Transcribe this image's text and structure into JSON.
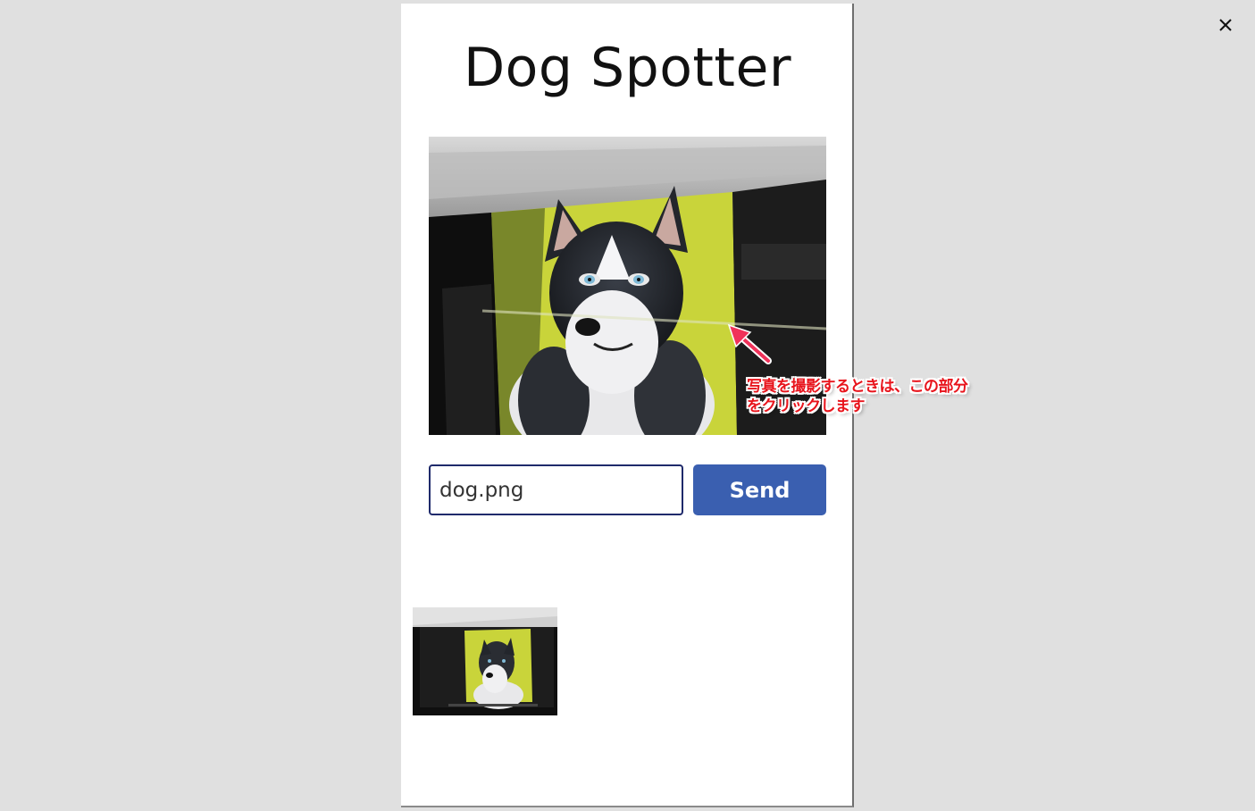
{
  "window": {
    "close_icon": "close-icon"
  },
  "app": {
    "title": "Dog Spotter",
    "camera": {
      "icon": "camera-preview",
      "accent_background": "#c9d43a"
    },
    "filename_input": {
      "value": "dog.png"
    },
    "send_button": {
      "label": "Send",
      "color": "#3a5fb0"
    },
    "thumbnail": {
      "icon": "photo-thumbnail"
    }
  },
  "annotation": {
    "text": "写真を撮影するときは、この部分\nをクリックします",
    "color": "#e8141c",
    "arrow_color": "#f0325a"
  }
}
